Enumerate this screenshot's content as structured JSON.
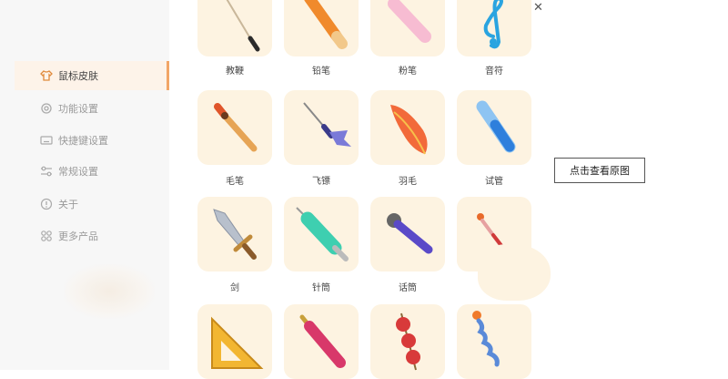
{
  "sidebar": {
    "items": [
      {
        "label": "鼠标皮肤",
        "icon": "shirt-icon",
        "active": true
      },
      {
        "label": "功能设置",
        "icon": "gear-icon",
        "active": false
      },
      {
        "label": "快捷键设置",
        "icon": "keyboard-icon",
        "active": false
      },
      {
        "label": "常规设置",
        "icon": "sliders-icon",
        "active": false
      },
      {
        "label": "关于",
        "icon": "info-icon",
        "active": false
      },
      {
        "label": "更多产品",
        "icon": "apps-grid-icon",
        "active": false
      }
    ]
  },
  "window": {
    "minimize": "—",
    "close": "✕"
  },
  "overlay": {
    "view_original": "点击查看原图"
  },
  "cursors": [
    {
      "label": "教鞭",
      "icon": "pointer-stick-icon"
    },
    {
      "label": "铅笔",
      "icon": "pencil-icon"
    },
    {
      "label": "粉笔",
      "icon": "chalk-icon"
    },
    {
      "label": "音符",
      "icon": "music-note-icon"
    },
    {
      "label": "毛笔",
      "icon": "brush-icon"
    },
    {
      "label": "飞镖",
      "icon": "dart-icon"
    },
    {
      "label": "羽毛",
      "icon": "feather-icon"
    },
    {
      "label": "试管",
      "icon": "test-tube-icon"
    },
    {
      "label": "剑",
      "icon": "sword-icon"
    },
    {
      "label": "针筒",
      "icon": "syringe-icon"
    },
    {
      "label": "话筒",
      "icon": "microphone-icon"
    },
    {
      "label": "",
      "icon": "pen-stick-icon"
    },
    {
      "label": "",
      "icon": "triangle-ruler-icon"
    },
    {
      "label": "",
      "icon": "fountain-pen-icon"
    },
    {
      "label": "",
      "icon": "candy-skewer-icon"
    },
    {
      "label": "",
      "icon": "twisted-wand-icon"
    }
  ],
  "colors": {
    "accent": "#f2a566",
    "card_bg": "#fdf3e1",
    "active_bg": "#fdf3e9"
  }
}
